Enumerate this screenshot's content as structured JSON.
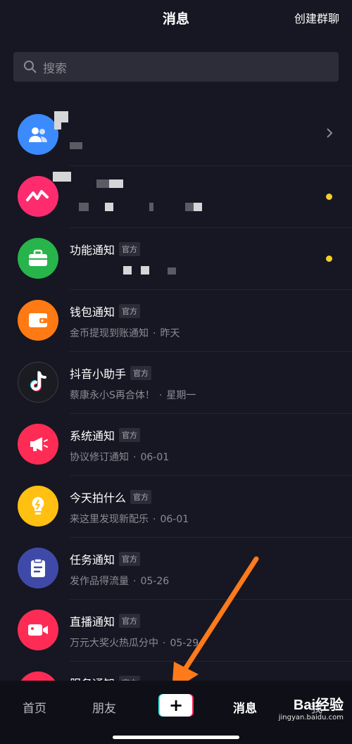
{
  "header": {
    "title": "消息",
    "create_group": "创建群聊"
  },
  "search": {
    "placeholder": "搜索"
  },
  "conversations": [
    {
      "name": "",
      "badge": "",
      "subtitle": "",
      "time": "",
      "avatar_color": "#3b8bff"
    },
    {
      "name": "",
      "badge": "",
      "subtitle": "",
      "time": "",
      "avatar_color": "#fe2c6f"
    },
    {
      "name": "功能通知",
      "badge": "官方",
      "subtitle": "",
      "time": "",
      "avatar_color": "#27b44a"
    },
    {
      "name": "钱包通知",
      "badge": "官方",
      "subtitle": "金币提现到账通知",
      "time": "昨天",
      "avatar_color": "#ff7a13"
    },
    {
      "name": "抖音小助手",
      "badge": "官方",
      "subtitle": "蔡康永小S再合体！",
      "time": "星期一",
      "avatar_color": "#1b1b22"
    },
    {
      "name": "系统通知",
      "badge": "官方",
      "subtitle": "协议修订通知",
      "time": "06-01",
      "avatar_color": "#fe2c55"
    },
    {
      "name": "今天拍什么",
      "badge": "官方",
      "subtitle": "来这里发现新配乐",
      "time": "06-01",
      "avatar_color": "#ffc012"
    },
    {
      "name": "任务通知",
      "badge": "官方",
      "subtitle": "发作品得流量",
      "time": "05-26",
      "avatar_color": "#3f4aa8"
    },
    {
      "name": "直播通知",
      "badge": "官方",
      "subtitle": "万元大奖火热瓜分中",
      "time": "05-29",
      "avatar_color": "#fe2c55"
    },
    {
      "name": "服务通知",
      "badge": "官方",
      "subtitle": "",
      "time": "",
      "avatar_color": "#fe2c55"
    }
  ],
  "unread_color": "#f4ce2b",
  "tabbar": {
    "home": "首页",
    "friends": "朋友",
    "messages": "消息",
    "me": "我"
  },
  "watermark": {
    "logo": "Bai经验",
    "url": "jingyan.baidu.com"
  },
  "annotation_color": "#ff7a1a"
}
